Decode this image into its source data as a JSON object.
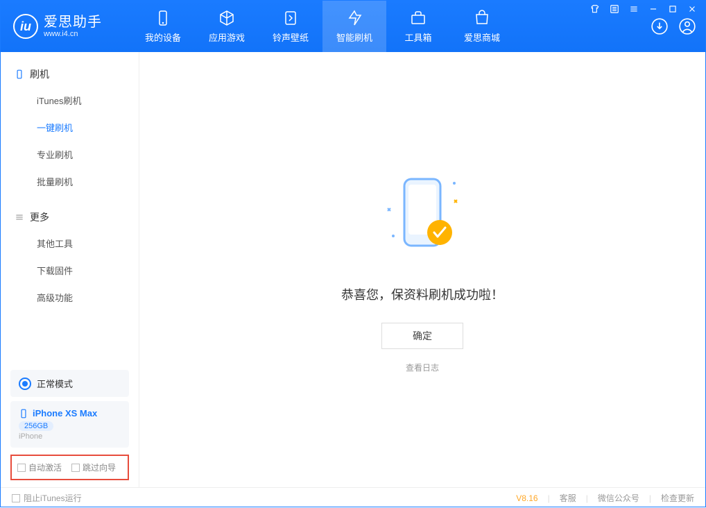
{
  "branding": {
    "title": "爱思助手",
    "subtitle": "www.i4.cn"
  },
  "nav": {
    "items": [
      {
        "label": "我的设备"
      },
      {
        "label": "应用游戏"
      },
      {
        "label": "铃声壁纸"
      },
      {
        "label": "智能刷机"
      },
      {
        "label": "工具箱"
      },
      {
        "label": "爱思商城"
      }
    ]
  },
  "sidebar": {
    "flash_header": "刷机",
    "flash_items": [
      "iTunes刷机",
      "一键刷机",
      "专业刷机",
      "批量刷机"
    ],
    "more_header": "更多",
    "more_items": [
      "其他工具",
      "下载固件",
      "高级功能"
    ],
    "mode_label": "正常模式",
    "device": {
      "name": "iPhone XS Max",
      "capacity": "256GB",
      "type": "iPhone"
    },
    "opt_auto_activate": "自动激活",
    "opt_skip_guide": "跳过向导"
  },
  "main": {
    "success_message": "恭喜您，保资料刷机成功啦！",
    "ok_button": "确定",
    "view_log": "查看日志"
  },
  "footer": {
    "block_itunes": "阻止iTunes运行",
    "version": "V8.16",
    "support": "客服",
    "wechat": "微信公众号",
    "check_update": "检查更新"
  }
}
